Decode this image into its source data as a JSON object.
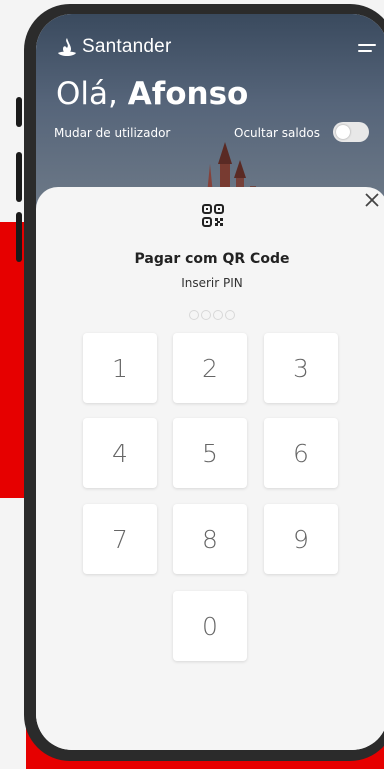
{
  "header": {
    "brand_name": "Santander",
    "greeting_prefix": "Olá, ",
    "greeting_name": "Afonso",
    "switch_user_label": "Mudar de utilizador",
    "hide_balances_label": "Ocultar saldos",
    "hide_balances_on": false
  },
  "modal": {
    "title": "Pagar com QR Code",
    "subtitle": "Inserir PIN",
    "pin_length": 4,
    "pin_entered": 0
  },
  "keypad": {
    "keys": [
      "1",
      "2",
      "3",
      "4",
      "5",
      "6",
      "7",
      "8",
      "9",
      "0"
    ]
  },
  "colors": {
    "brand_red": "#e60000",
    "sheet_bg": "#f5f5f5",
    "phone_frame": "#2b2b2b"
  },
  "icons": [
    "santander-flame-icon",
    "menu-icon",
    "close-icon",
    "qr-code-icon"
  ]
}
